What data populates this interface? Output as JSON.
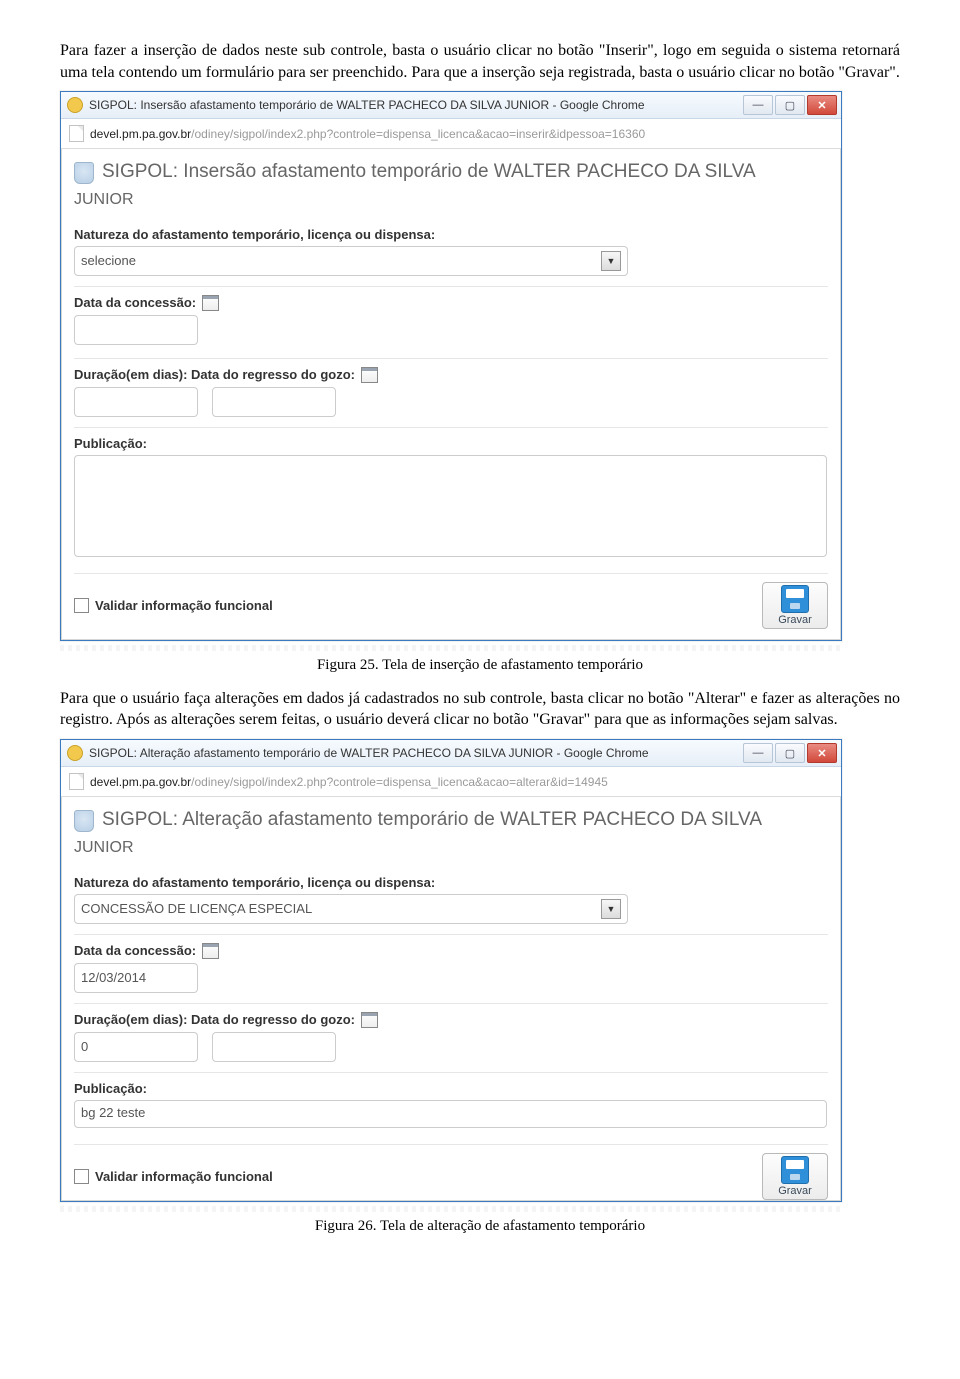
{
  "para1": "Para fazer a inserção de dados neste sub controle, basta o usuário clicar no botão \"Inserir\", logo em seguida o sistema retornará uma tela contendo um formulário para ser preenchido. Para que a inserção seja registrada, basta o usuário clicar no botão \"Gravar\".",
  "win1": {
    "title": "SIGPOL: Insersão afastamento temporário de WALTER PACHECO DA SILVA JUNIOR - Google Chrome",
    "url_host": "devel.pm.pa.gov.br",
    "url_path": "/odiney/sigpol/index2.php?controle=dispensa_licenca&acao=inserir&idpessoa=16360",
    "app_title_line1": "SIGPOL: Insersão afastamento temporário de WALTER PACHECO DA SILVA",
    "app_title_line2": "JUNIOR",
    "f_natureza_label": "Natureza do afastamento temporário, licença ou dispensa:",
    "f_natureza_value": "selecione",
    "f_data_label": "Data da concessão:",
    "f_data_value": "",
    "f_dur_label": "Duração(em dias): Data do regresso do gozo:",
    "f_dur_v1": "",
    "f_dur_v2": "",
    "f_pub_label": "Publicação:",
    "f_pub_value": "",
    "chk_label": "Validar informação funcional",
    "save_label": "Gravar"
  },
  "caption1": "Figura 25. Tela de inserção de afastamento temporário",
  "para2": "Para que o usuário faça alterações em dados já cadastrados no sub controle, basta clicar no botão \"Alterar\" e fazer as alterações no registro. Após as alterações serem feitas, o usuário deverá clicar no botão \"Gravar\" para que as informações sejam salvas.",
  "win2": {
    "title": "SIGPOL: Alteração afastamento temporário de WALTER PACHECO DA SILVA JUNIOR - Google Chrome",
    "url_host": "devel.pm.pa.gov.br",
    "url_path": "/odiney/sigpol/index2.php?controle=dispensa_licenca&acao=alterar&id=14945",
    "app_title_line1": "SIGPOL: Alteração afastamento temporário de WALTER PACHECO DA SILVA",
    "app_title_line2": "JUNIOR",
    "f_natureza_label": "Natureza do afastamento temporário, licença ou dispensa:",
    "f_natureza_value": "CONCESSÃO DE LICENÇA ESPECIAL",
    "f_data_label": "Data da concessão:",
    "f_data_value": "12/03/2014",
    "f_dur_label": "Duração(em dias): Data do regresso do gozo:",
    "f_dur_v1": "0",
    "f_dur_v2": "",
    "f_pub_label": "Publicação:",
    "f_pub_value": "bg 22 teste",
    "chk_label": "Validar informação funcional",
    "save_label": "Gravar"
  },
  "caption2": "Figura 26. Tela de alteração de afastamento temporário",
  "winbtn": {
    "min": "—",
    "max": "▢",
    "close": "✕",
    "dd": "▼"
  }
}
